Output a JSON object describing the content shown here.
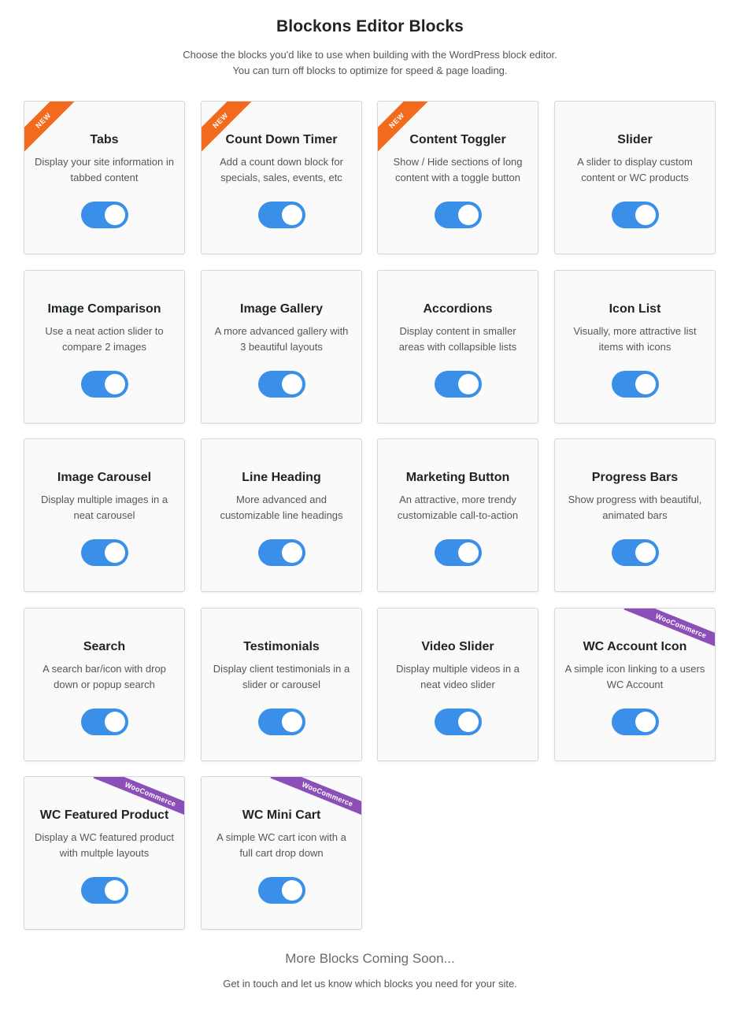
{
  "header": {
    "title": "Blockons Editor Blocks",
    "description_line1": "Choose the blocks you'd like to use when building with the WordPress block editor.",
    "description_line2": "You can turn off blocks to optimize for speed & page loading."
  },
  "colors": {
    "toggle_on": "#3a8fe8",
    "new_badge": "#f26a1b",
    "woo_badge": "#8c4fb8"
  },
  "blocks": [
    {
      "title": "Tabs",
      "description": "Display your site information in tabbed content",
      "badge": "NEW",
      "enabled": true
    },
    {
      "title": "Count Down Timer",
      "description": "Add a count down block for specials, sales, events, etc",
      "badge": "NEW",
      "enabled": true
    },
    {
      "title": "Content Toggler",
      "description": "Show / Hide sections of long content with a toggle button",
      "badge": "NEW",
      "enabled": true
    },
    {
      "title": "Slider",
      "description": "A slider to display custom content or WC products",
      "badge": "",
      "enabled": true
    },
    {
      "title": "Image Comparison",
      "description": "Use a neat action slider to compare 2 images",
      "badge": "",
      "enabled": true
    },
    {
      "title": "Image Gallery",
      "description": "A more advanced gallery with 3 beautiful layouts",
      "badge": "",
      "enabled": true
    },
    {
      "title": "Accordions",
      "description": "Display content in smaller areas with collapsible lists",
      "badge": "",
      "enabled": true
    },
    {
      "title": "Icon List",
      "description": "Visually, more attractive list items with icons",
      "badge": "",
      "enabled": true
    },
    {
      "title": "Image Carousel",
      "description": "Display multiple images in a neat carousel",
      "badge": "",
      "enabled": true
    },
    {
      "title": "Line Heading",
      "description": "More advanced and customizable line headings",
      "badge": "",
      "enabled": true
    },
    {
      "title": "Marketing Button",
      "description": "An attractive, more trendy customizable call-to-action",
      "badge": "",
      "enabled": true
    },
    {
      "title": "Progress Bars",
      "description": "Show progress with beautiful, animated bars",
      "badge": "",
      "enabled": true
    },
    {
      "title": "Search",
      "description": "A search bar/icon with drop down or popup search",
      "badge": "",
      "enabled": true
    },
    {
      "title": "Testimonials",
      "description": "Display client testimonials in a slider or carousel",
      "badge": "",
      "enabled": true
    },
    {
      "title": "Video Slider",
      "description": "Display multiple videos in a neat video slider",
      "badge": "",
      "enabled": true
    },
    {
      "title": "WC Account Icon",
      "description": "A simple icon linking to a users WC Account",
      "badge": "WooCommerce",
      "enabled": true
    },
    {
      "title": "WC Featured Product",
      "description": "Display a WC featured product with multple layouts",
      "badge": "WooCommerce",
      "enabled": true
    },
    {
      "title": "WC Mini Cart",
      "description": "A simple WC cart icon with a full cart drop down",
      "badge": "WooCommerce",
      "enabled": true
    }
  ],
  "footer": {
    "title": "More Blocks Coming Soon...",
    "description": "Get in touch and let us know which blocks you need for your site."
  }
}
